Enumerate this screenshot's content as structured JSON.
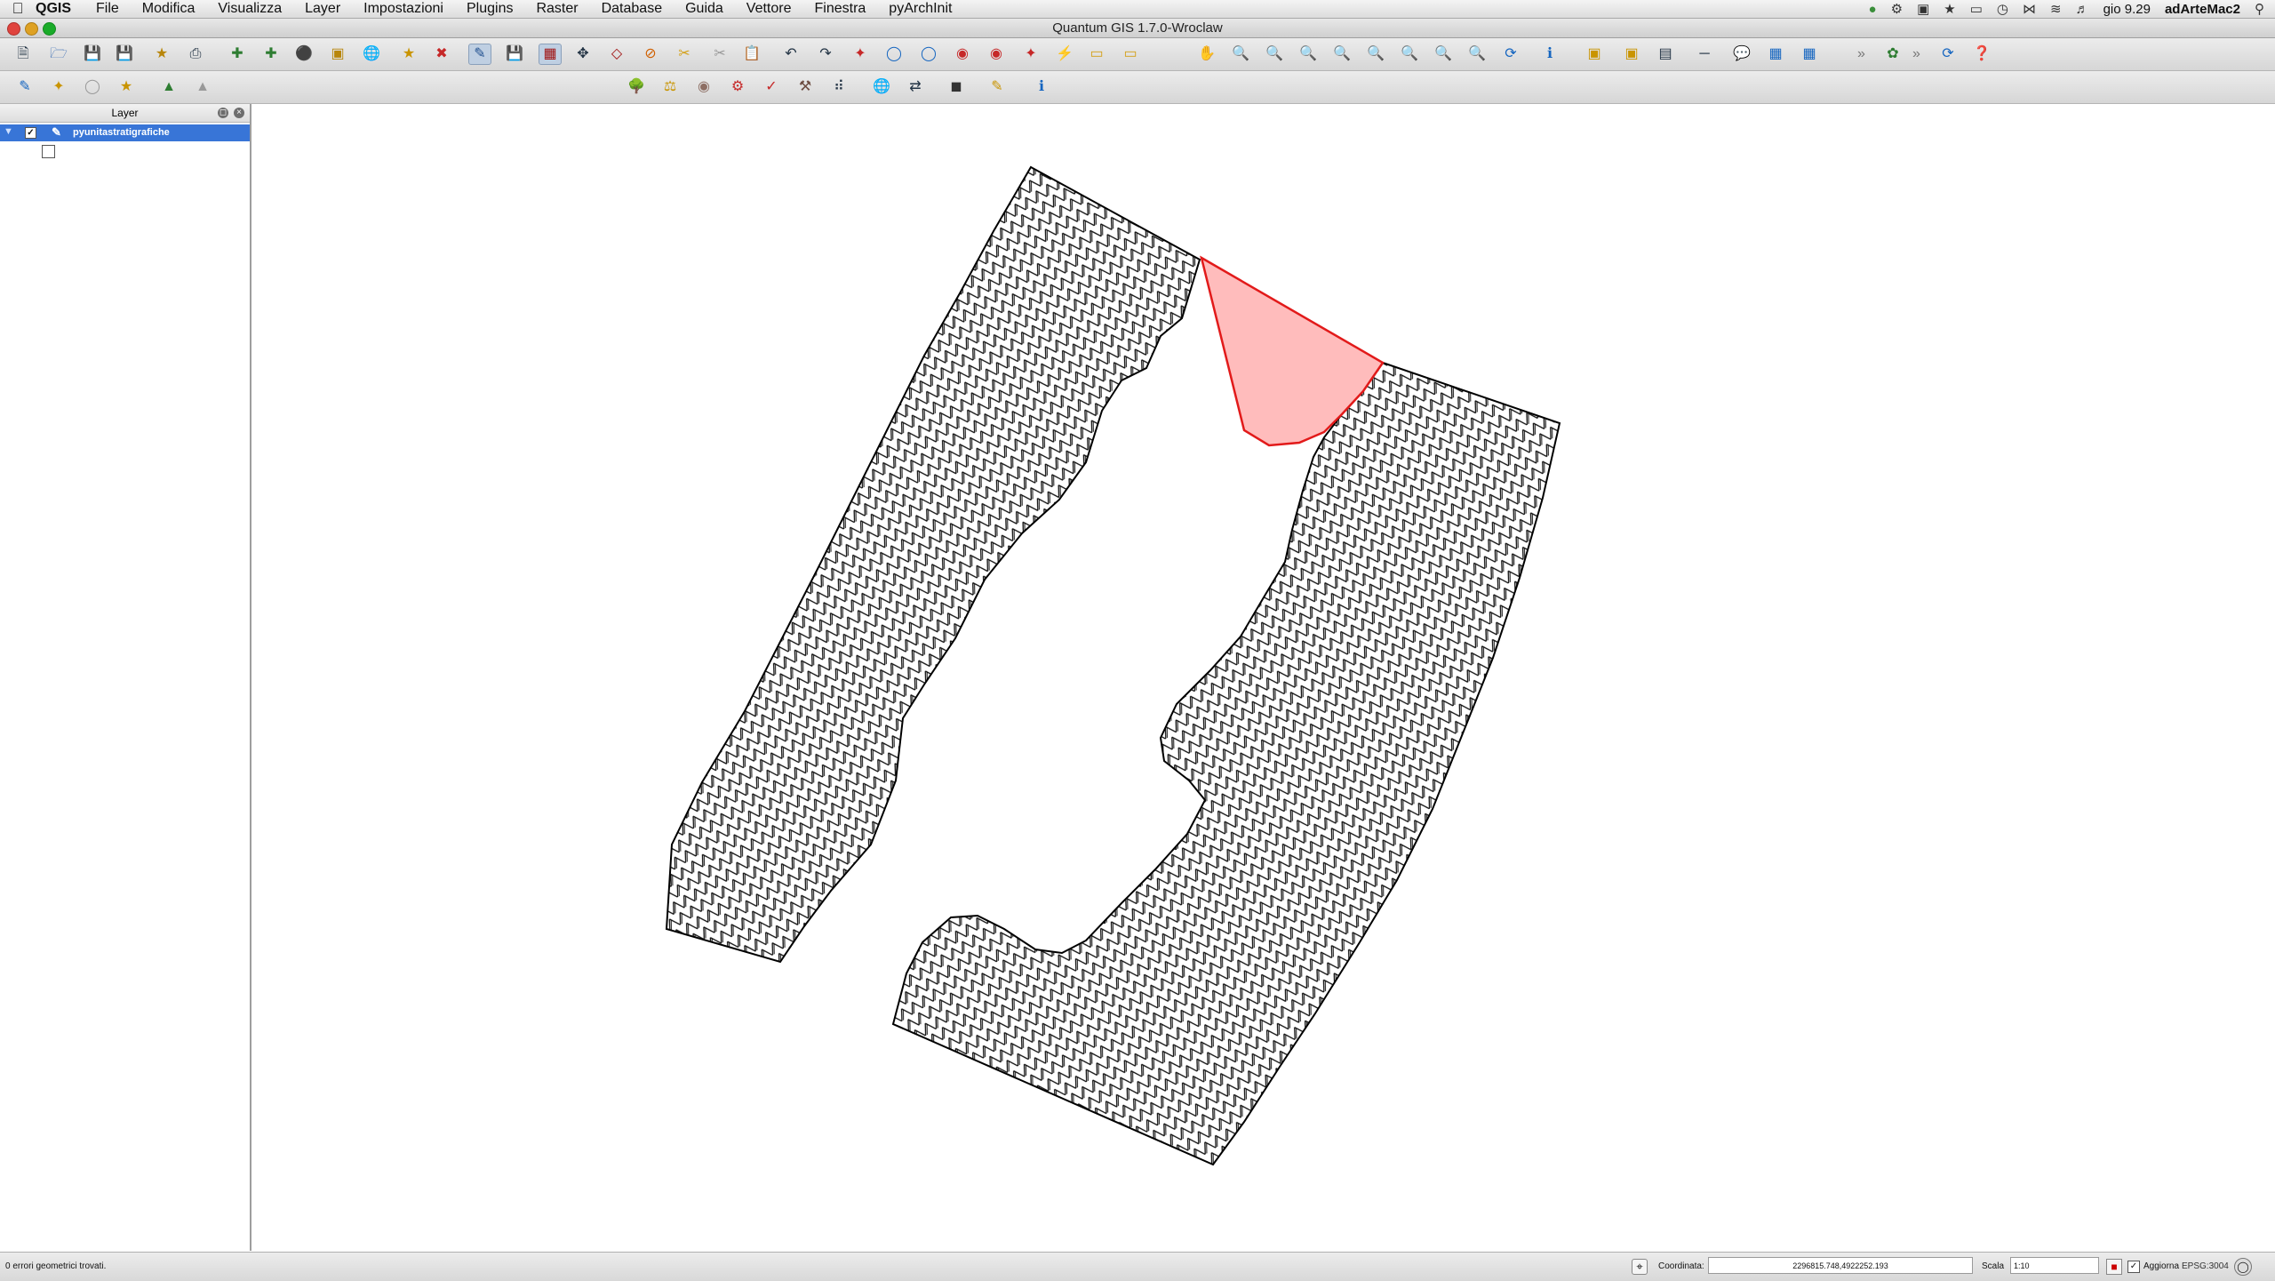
{
  "menubar": {
    "app_name": "QGIS",
    "menus": [
      "File",
      "Modifica",
      "Visualizza",
      "Layer",
      "Impostazioni",
      "Plugins",
      "Raster",
      "Database",
      "Guida",
      "Vettore",
      "Finestra",
      "pyArchInit"
    ],
    "clock": "gio 9.29",
    "user": "adArteMac2"
  },
  "window": {
    "title": "Quantum GIS 1.7.0-Wroclaw"
  },
  "layers_panel": {
    "title": "Layer",
    "layers": [
      {
        "name": "pyunitastratigrafiche",
        "visible": true,
        "selected": true
      }
    ]
  },
  "map": {
    "polygon_fill": "none",
    "polygon_stroke": "#000000",
    "selected_fill": "#ffbcbc",
    "selected_stroke": "#e21a1a",
    "hatch_pattern": "herringbone"
  },
  "statusbar": {
    "message": "0 errori geometrici trovati.",
    "coord_label": "Coordinata:",
    "coordinate": "2296815.748,4922252.193",
    "scale_label": "Scala",
    "scale": "1:10",
    "render_label": "Aggiorna",
    "render_checked": true,
    "crs": "EPSG:3004"
  },
  "colors": {
    "selection": "#3875d7",
    "toolbar_bg": "#e0e0e0"
  }
}
